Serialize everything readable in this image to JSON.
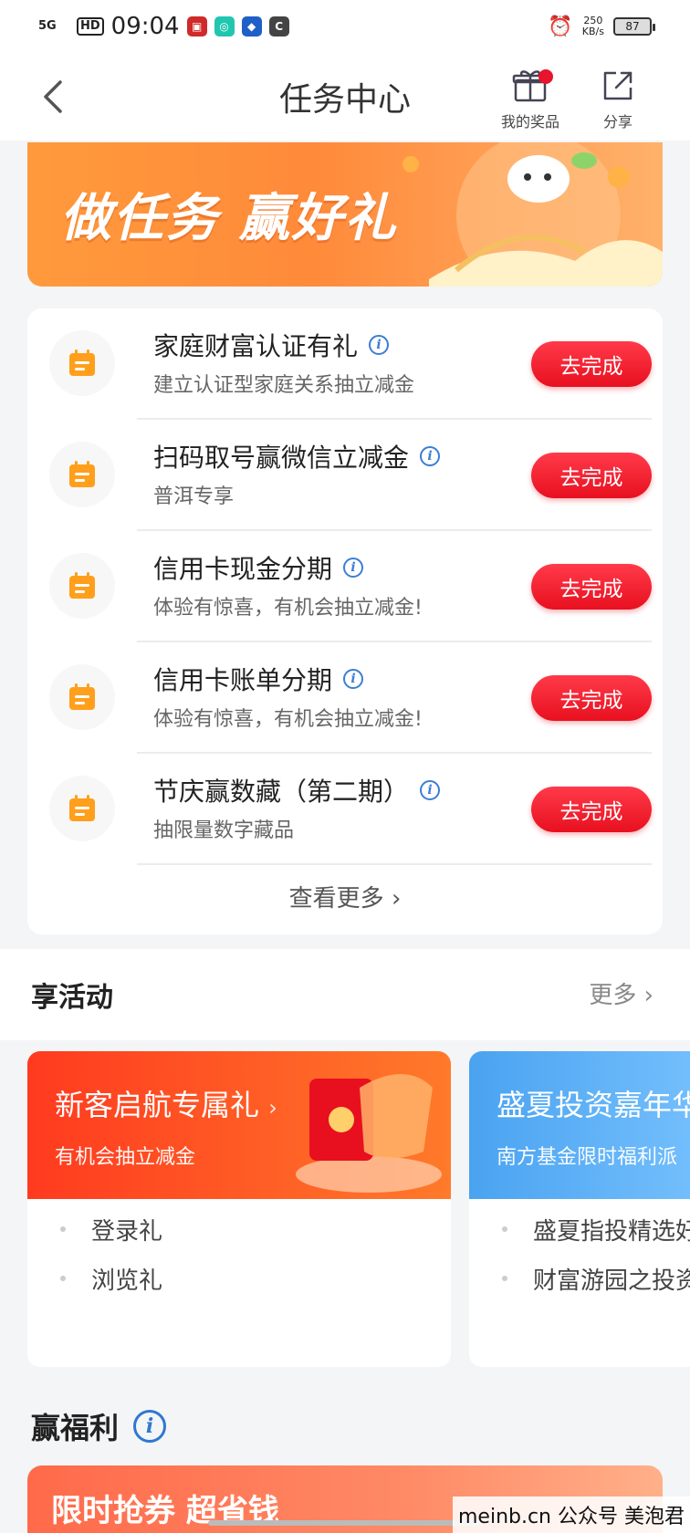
{
  "status_bar": {
    "signal": "5G",
    "hd": "HD",
    "time": "09:04",
    "speed_value": "250",
    "speed_unit": "KB/s",
    "battery": "87"
  },
  "nav": {
    "title": "任务中心",
    "my_prizes": "我的奖品",
    "share": "分享"
  },
  "banner": {
    "text": "做任务 赢好礼"
  },
  "tasks": [
    {
      "title": "家庭财富认证有礼",
      "subtitle": "建立认证型家庭关系抽立减金",
      "button": "去完成"
    },
    {
      "title": "扫码取号赢微信立减金",
      "subtitle": "普洱专享",
      "button": "去完成"
    },
    {
      "title": "信用卡现金分期",
      "subtitle": "体验有惊喜，有机会抽立减金!",
      "button": "去完成"
    },
    {
      "title": "信用卡账单分期",
      "subtitle": "体验有惊喜，有机会抽立减金!",
      "button": "去完成"
    },
    {
      "title": "节庆赢数藏（第二期）",
      "subtitle": "抽限量数字藏品",
      "button": "去完成"
    }
  ],
  "view_more": "查看更多",
  "activities_section": {
    "title": "享活动",
    "more": "更多"
  },
  "activities": [
    {
      "title": "新客启航专属礼",
      "subtitle": "有机会抽立减金",
      "items": [
        "登录礼",
        "浏览礼"
      ],
      "color": "#ff4a2a"
    },
    {
      "title": "盛夏投资嘉年华",
      "subtitle": "南方基金限时福利派",
      "items": [
        "盛夏指投精选好",
        "财富游园之投资"
      ],
      "color": "#4aa3f0"
    }
  ],
  "welfare": {
    "title": "赢福利"
  },
  "coupon_banner": {
    "text": "限时抢券 超省钱"
  },
  "watermark": "meinb.cn  公众号 美泡君",
  "colors": {
    "accent_red": "#e8101f",
    "banner_orange": "#ff8a3a",
    "info_blue": "#3b7fd4"
  }
}
